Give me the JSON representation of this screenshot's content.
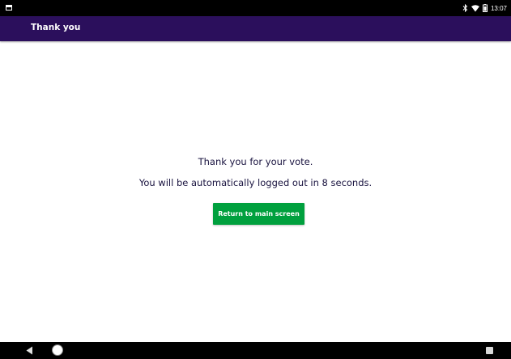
{
  "status_bar": {
    "time": "13:07",
    "icons": [
      "notification-icon",
      "bluetooth-icon",
      "wifi-icon",
      "battery-icon"
    ]
  },
  "app_bar": {
    "title": "Thank you",
    "background_color": "#2b0f5c"
  },
  "main": {
    "message_primary": "Thank you for your vote.",
    "message_secondary": "You will be automatically logged out in 8 seconds.",
    "return_button_label": "Return to main screen",
    "button_color": "#00a03e"
  },
  "nav_bar": {
    "icons": [
      "back-icon",
      "home-icon",
      "recents-icon"
    ]
  }
}
